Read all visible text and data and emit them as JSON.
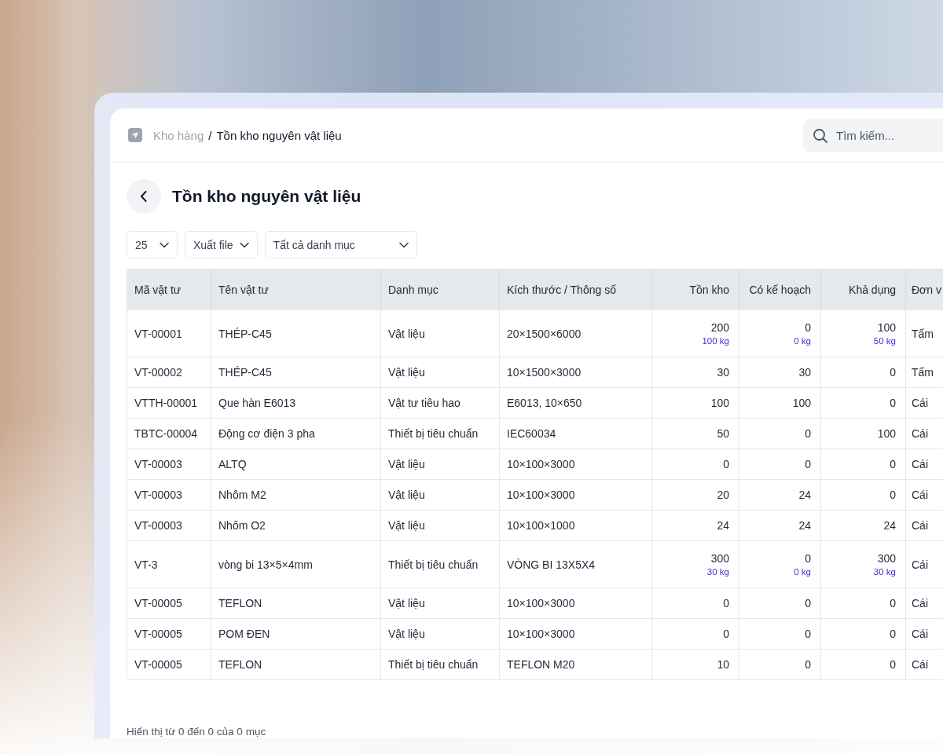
{
  "breadcrumb": {
    "parent": "Kho hàng",
    "separator": "/",
    "current": "Tồn kho nguyên vật liệu"
  },
  "search": {
    "placeholder": "Tìm kiếm..."
  },
  "page_title": "Tồn kho nguyên vật liệu",
  "toolbar": {
    "page_size": "25",
    "export": "Xuất file",
    "category_filter": "Tất cả danh mục"
  },
  "table": {
    "columns": [
      "Mã vật tư",
      "Tên vật tư",
      "Danh mục",
      "Kích thước / Thông số",
      "Tồn kho",
      "Có kế hoạch",
      "Khả dụng",
      "Đơn v"
    ],
    "rows": [
      {
        "code": "VT-00001",
        "name": "THÉP-C45",
        "category": "Vật liệu",
        "spec": "20×1500×6000",
        "stock": {
          "value": "200",
          "sub": "100 kg"
        },
        "planned": {
          "value": "0",
          "sub": "0 kg"
        },
        "available": {
          "value": "100",
          "sub": "50 kg"
        },
        "unit": "Tấm"
      },
      {
        "code": "VT-00002",
        "name": "THÉP-C45",
        "category": "Vật liệu",
        "spec": "10×1500×3000",
        "stock": {
          "value": "30"
        },
        "planned": {
          "value": "30"
        },
        "available": {
          "value": "0"
        },
        "unit": "Tấm"
      },
      {
        "code": "VTTH-00001",
        "name": "Que hàn E6013",
        "category": "Vật tư tiêu hao",
        "spec": "E6013, 10×650",
        "stock": {
          "value": "100"
        },
        "planned": {
          "value": "100"
        },
        "available": {
          "value": "0"
        },
        "unit": "Cái"
      },
      {
        "code": "TBTC-00004",
        "name": "Động cơ điện 3 pha",
        "category": "Thiết bị tiêu chuẩn",
        "spec": "IEC60034",
        "stock": {
          "value": "50"
        },
        "planned": {
          "value": "0"
        },
        "available": {
          "value": "100"
        },
        "unit": "Cái"
      },
      {
        "code": "VT-00003",
        "name": "ALTQ",
        "category": "Vật liệu",
        "spec": "10×100×3000",
        "stock": {
          "value": "0"
        },
        "planned": {
          "value": "0"
        },
        "available": {
          "value": "0"
        },
        "unit": "Cái"
      },
      {
        "code": "VT-00003",
        "name": "Nhôm M2",
        "category": "Vật liệu",
        "spec": "10×100×3000",
        "stock": {
          "value": "20"
        },
        "planned": {
          "value": "24"
        },
        "available": {
          "value": "0"
        },
        "unit": "Cái"
      },
      {
        "code": "VT-00003",
        "name": "Nhôm O2",
        "category": "Vật liệu",
        "spec": "10×100×1000",
        "stock": {
          "value": "24"
        },
        "planned": {
          "value": "24"
        },
        "available": {
          "value": "24"
        },
        "unit": "Cái"
      },
      {
        "code": "VT-3",
        "name": "vòng bi 13×5×4mm",
        "category": "Thiết bị tiêu chuẩn",
        "spec": "VÒNG BI 13X5X4",
        "stock": {
          "value": "300",
          "sub": "30 kg"
        },
        "planned": {
          "value": "0",
          "sub": "0 kg"
        },
        "available": {
          "value": "300",
          "sub": "30 kg"
        },
        "unit": "Cái"
      },
      {
        "code": "VT-00005",
        "name": "TEFLON",
        "category": "Vật liệu",
        "spec": "10×100×3000",
        "stock": {
          "value": "0"
        },
        "planned": {
          "value": "0"
        },
        "available": {
          "value": "0"
        },
        "unit": "Cái"
      },
      {
        "code": "VT-00005",
        "name": "POM ĐEN",
        "category": "Vật liệu",
        "spec": "10×100×3000",
        "stock": {
          "value": "0"
        },
        "planned": {
          "value": "0"
        },
        "available": {
          "value": "0"
        },
        "unit": "Cái"
      },
      {
        "code": "VT-00005",
        "name": "TEFLON",
        "category": "Thiết bị tiêu chuẩn",
        "spec": "TEFLON M20",
        "stock": {
          "value": "10"
        },
        "planned": {
          "value": "0"
        },
        "available": {
          "value": "0"
        },
        "unit": "Cái"
      }
    ]
  },
  "footer": "Hiển thị từ 0 đến 0 của 0 mục"
}
